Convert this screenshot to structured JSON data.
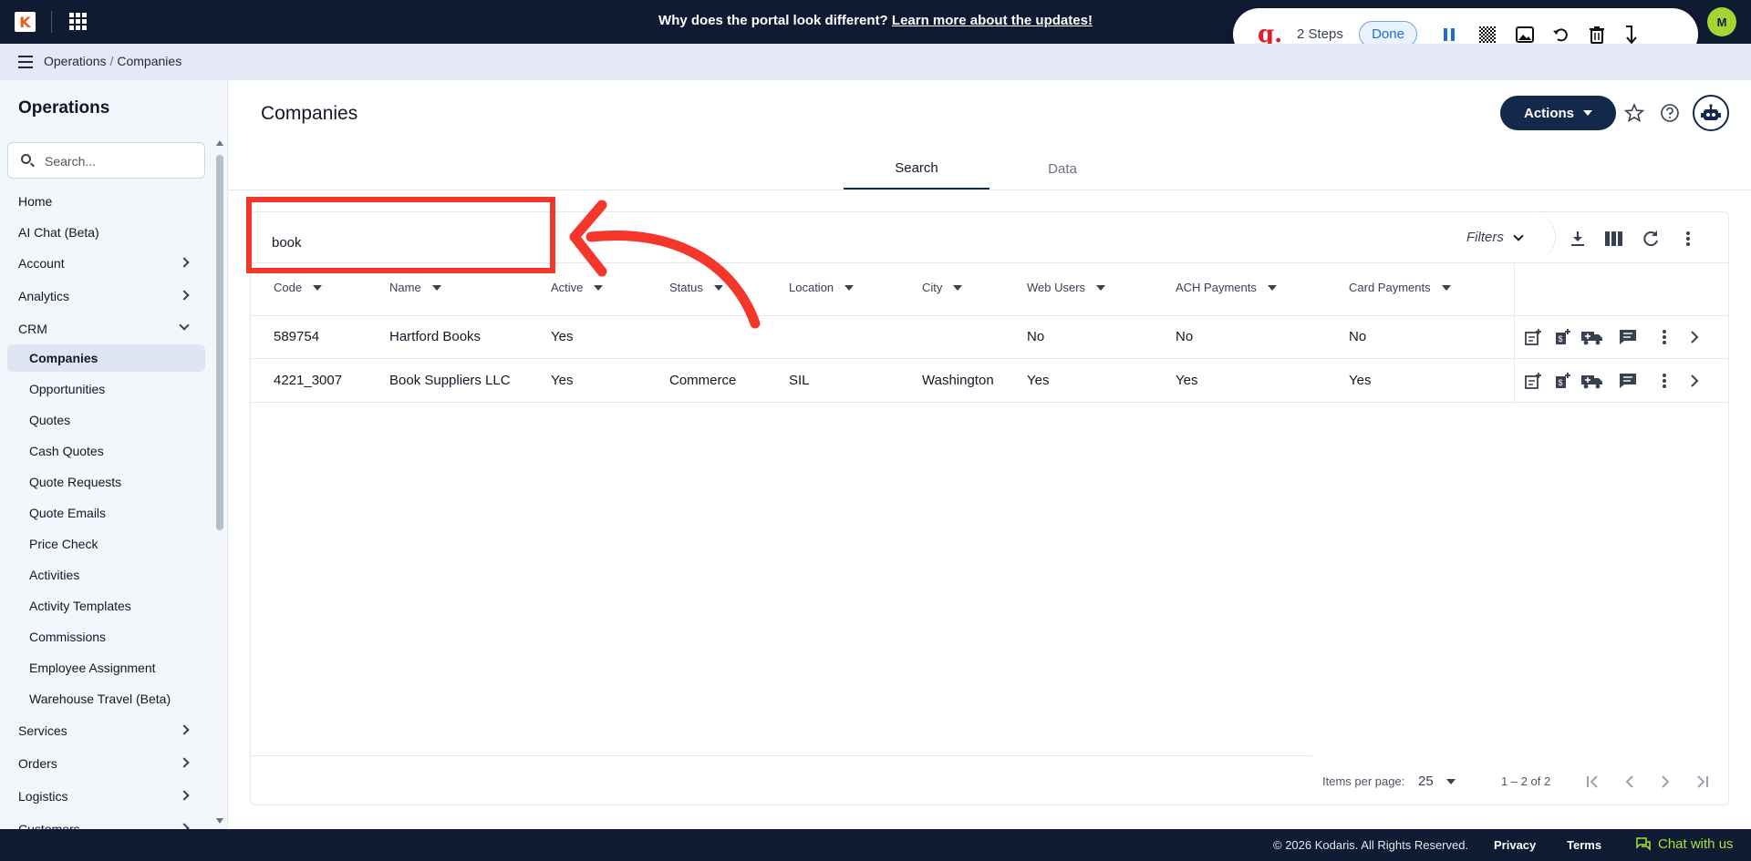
{
  "topbar": {
    "logo_letter": "K",
    "banner_question": "Why does the portal look different?",
    "banner_link": "Learn more about the updates!",
    "user_initial": "M"
  },
  "recorder": {
    "logo": "g.",
    "steps": "2 Steps",
    "done_label": "Done"
  },
  "breadcrumb": {
    "items": [
      "Operations",
      "Companies"
    ]
  },
  "sidebar": {
    "title": "Operations",
    "search_placeholder": "Search...",
    "items": [
      {
        "label": "Home"
      },
      {
        "label": "AI Chat (Beta)"
      },
      {
        "label": "Account"
      },
      {
        "label": "Analytics"
      },
      {
        "label": "CRM"
      },
      {
        "label": "Companies"
      },
      {
        "label": "Opportunities"
      },
      {
        "label": "Quotes"
      },
      {
        "label": "Cash Quotes"
      },
      {
        "label": "Quote Requests"
      },
      {
        "label": "Quote Emails"
      },
      {
        "label": "Price Check"
      },
      {
        "label": "Activities"
      },
      {
        "label": "Activity Templates"
      },
      {
        "label": "Commissions"
      },
      {
        "label": "Employee Assignment"
      },
      {
        "label": "Warehouse Travel (Beta)"
      },
      {
        "label": "Services"
      },
      {
        "label": "Orders"
      },
      {
        "label": "Logistics"
      },
      {
        "label": "Customers"
      }
    ]
  },
  "main": {
    "title": "Companies",
    "actions_label": "Actions",
    "tabs": [
      {
        "label": "Search"
      },
      {
        "label": "Data"
      }
    ],
    "search_value": "book",
    "filters_label": "Filters",
    "columns": [
      "Code",
      "Name",
      "Active",
      "Status",
      "Location",
      "City",
      "Web Users",
      "ACH Payments",
      "Card Payments"
    ],
    "rows": [
      {
        "code": "589754",
        "name": "Hartford Books",
        "active": "Yes",
        "status": "",
        "location": "",
        "city": "",
        "web_users": "No",
        "ach": "No",
        "card": "No"
      },
      {
        "code": "4221_3007",
        "name": "Book Suppliers LLC",
        "active": "Yes",
        "status": "Commerce",
        "location": "SIL",
        "city": "Washington",
        "web_users": "Yes",
        "ach": "Yes",
        "card": "Yes"
      }
    ],
    "pager": {
      "items_per_page_label": "Items per page:",
      "items_per_page": "25",
      "range": "1 – 2 of 2"
    }
  },
  "footer": {
    "copyright": "© 2026 Kodaris. All Rights Reserved.",
    "privacy": "Privacy",
    "terms": "Terms",
    "chat": "Chat with us"
  },
  "colors": {
    "navy": "#0f1a33",
    "brand_button": "#13294b",
    "accent_green": "#a3e635",
    "annotation_red": "#f4362b"
  }
}
